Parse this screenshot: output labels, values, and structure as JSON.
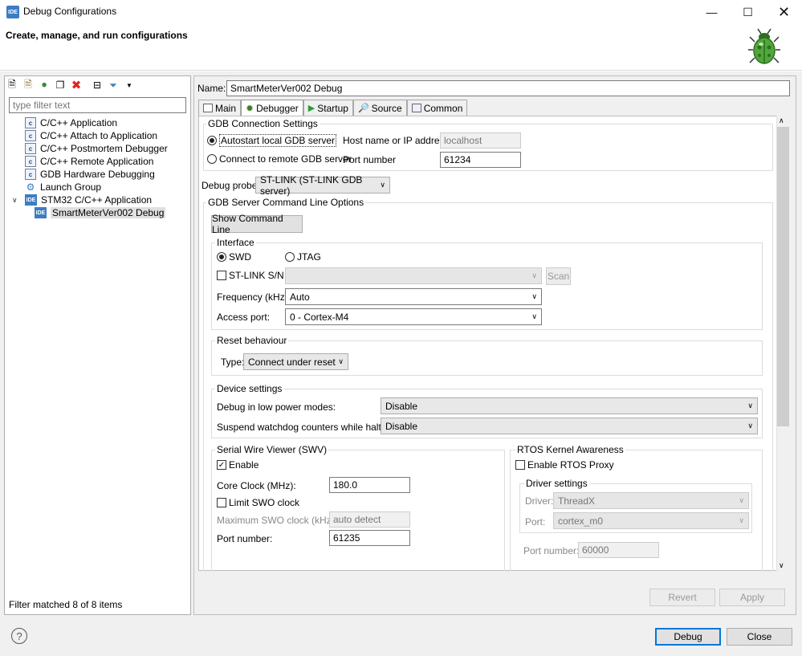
{
  "window": {
    "title": "Debug Configurations",
    "header": "Create, manage, and run configurations"
  },
  "left": {
    "filter_placeholder": "type filter text",
    "tree": [
      {
        "label": "C/C++ Application"
      },
      {
        "label": "C/C++ Attach to Application"
      },
      {
        "label": "C/C++ Postmortem Debugger"
      },
      {
        "label": "C/C++ Remote Application"
      },
      {
        "label": "GDB Hardware Debugging"
      },
      {
        "label": "Launch Group"
      },
      {
        "label": "STM32 C/C++ Application"
      },
      {
        "label": "SmartMeterVer002 Debug"
      }
    ],
    "status": "Filter matched 8 of 8 items"
  },
  "config": {
    "name_label": "Name:",
    "name_value": "SmartMeterVer002 Debug",
    "tabs": [
      "Main",
      "Debugger",
      "Startup",
      "Source",
      "Common"
    ]
  },
  "gdb": {
    "group": "GDB Connection Settings",
    "autostart": "Autostart local GDB server",
    "remote": "Connect to remote GDB server",
    "host_label": "Host name or IP address",
    "host_value": "localhost",
    "port_label": "Port number",
    "port_value": "61234"
  },
  "probe": {
    "label": "Debug probe",
    "value": "ST-LINK (ST-LINK GDB server)"
  },
  "server": {
    "group": "GDB Server Command Line Options",
    "show_cmd": "Show Command Line",
    "interface_group": "Interface",
    "swd": "SWD",
    "jtag": "JTAG",
    "stlink_sn": "ST-LINK S/N",
    "scan": "Scan",
    "freq_label": "Frequency (kHz):",
    "freq_value": "Auto",
    "access_label": "Access port:",
    "access_value": "0 - Cortex-M4"
  },
  "reset": {
    "group": "Reset behaviour",
    "type_label": "Type:",
    "type_value": "Connect under reset"
  },
  "device": {
    "group": "Device settings",
    "lowpower_label": "Debug in low power modes:",
    "lowpower_value": "Disable",
    "watchdog_label": "Suspend watchdog counters while halted:",
    "watchdog_value": "Disable"
  },
  "swv": {
    "group": "Serial Wire Viewer (SWV)",
    "enable": "Enable",
    "core_clock_label": "Core Clock (MHz):",
    "core_clock_value": "180.0",
    "limit_swo": "Limit SWO clock",
    "max_swo_label": "Maximum SWO clock (kHz):",
    "max_swo_value": "auto detect",
    "port_label": "Port number:",
    "port_value": "61235"
  },
  "rtos": {
    "group": "RTOS Kernel Awareness",
    "enable_proxy": "Enable RTOS Proxy",
    "driver_group": "Driver settings",
    "driver_label": "Driver:",
    "driver_value": "ThreadX",
    "port_label": "Port:",
    "port_value": "cortex_m0",
    "port_number_label": "Port number:",
    "port_number_value": "60000"
  },
  "buttons": {
    "revert": "Revert",
    "apply": "Apply",
    "debug": "Debug",
    "close": "Close"
  },
  "colors": {
    "accent": "#3c7dc4",
    "bug_green": "#4fa83a"
  }
}
